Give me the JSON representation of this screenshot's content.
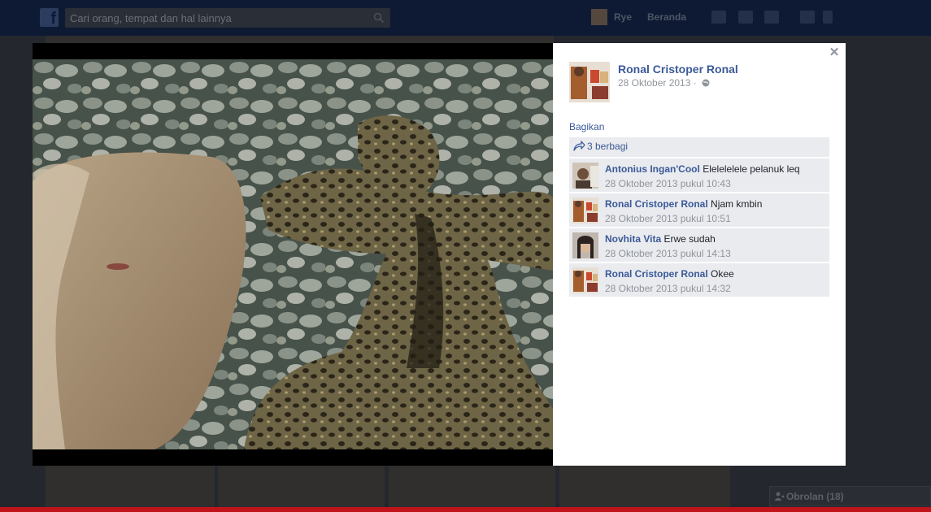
{
  "topbar": {
    "search_placeholder": "Cari orang, tempat dan hal lainnya",
    "user_name": "Rye",
    "home_label": "Beranda"
  },
  "post": {
    "author": "Ronal Cristoper Ronal",
    "date": "28 Oktober 2013",
    "meta_separator": "·",
    "share_link": "Bagikan",
    "share_count": "3 berbagi"
  },
  "comments": [
    {
      "author": "Antonius Ingan'Cool",
      "text": "Elelelelele pelanuk leq",
      "time": "28 Oktober 2013 pukul 10:43"
    },
    {
      "author": "Ronal Cristoper Ronal",
      "text": "Njam kmbin",
      "time": "28 Oktober 2013 pukul 10:51"
    },
    {
      "author": "Novhita Vita",
      "text": "Erwe sudah",
      "time": "28 Oktober 2013 pukul 14:13"
    },
    {
      "author": "Ronal Cristoper Ronal",
      "text": "Okee",
      "time": "28 Oktober 2013 pukul 14:32"
    }
  ],
  "chat": {
    "label": "Obrolan (18)"
  },
  "colors": {
    "topbar": "#0e1a33",
    "link": "#3b5998",
    "comment_bg": "#e9ebee",
    "bottom_bar": "#c1141a"
  }
}
